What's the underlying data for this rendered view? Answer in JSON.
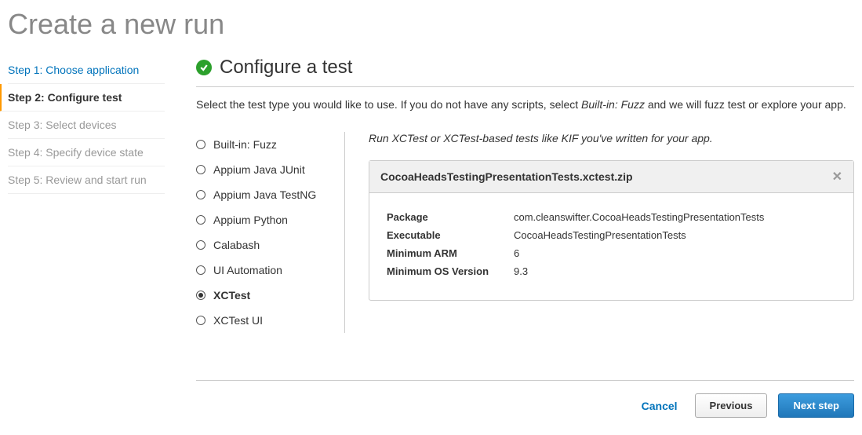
{
  "page_title": "Create a new run",
  "steps": [
    {
      "label": "Step 1: Choose application",
      "state": "completed"
    },
    {
      "label": "Step 2: Configure test",
      "state": "active"
    },
    {
      "label": "Step 3: Select devices",
      "state": "pending"
    },
    {
      "label": "Step 4: Specify device state",
      "state": "pending"
    },
    {
      "label": "Step 5: Review and start run",
      "state": "pending"
    }
  ],
  "section": {
    "title": "Configure a test",
    "description_before": "Select the test type you would like to use. If you do not have any scripts, select ",
    "description_italic": "Built-in: Fuzz",
    "description_after": " and we will fuzz test or explore your app."
  },
  "test_types": [
    {
      "label": "Built-in: Fuzz",
      "selected": false
    },
    {
      "label": "Appium Java JUnit",
      "selected": false
    },
    {
      "label": "Appium Java TestNG",
      "selected": false
    },
    {
      "label": "Appium Python",
      "selected": false
    },
    {
      "label": "Calabash",
      "selected": false
    },
    {
      "label": "UI Automation",
      "selected": false
    },
    {
      "label": "XCTest",
      "selected": true
    },
    {
      "label": "XCTest UI",
      "selected": false
    }
  ],
  "detail": {
    "hint": "Run XCTest or XCTest-based tests like KIF you've written for your app.",
    "filename": "CocoaHeadsTestingPresentationTests.xctest.zip",
    "rows": {
      "package_label": "Package",
      "package_value": "com.cleanswifter.CocoaHeadsTestingPresentationTests",
      "executable_label": "Executable",
      "executable_value": "CocoaHeadsTestingPresentationTests",
      "min_arm_label": "Minimum ARM",
      "min_arm_value": "6",
      "min_os_label": "Minimum OS Version",
      "min_os_value": "9.3"
    }
  },
  "actions": {
    "cancel": "Cancel",
    "previous": "Previous",
    "next": "Next step"
  }
}
